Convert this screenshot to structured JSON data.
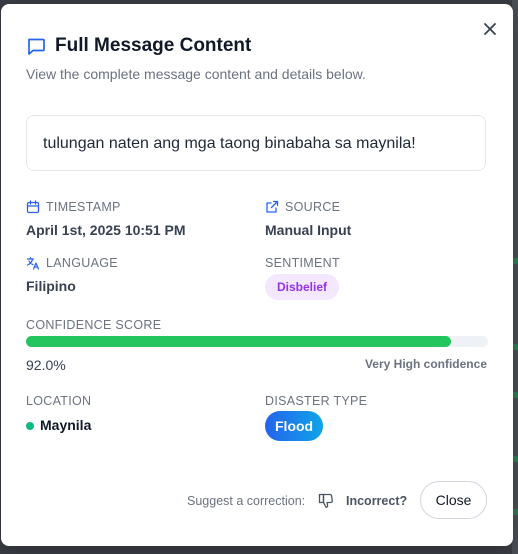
{
  "dialog": {
    "title": "Full Message Content",
    "subtitle": "View the complete message content and details below."
  },
  "message": {
    "text": "tulungan naten ang mga taong binabaha sa maynila!"
  },
  "details": {
    "timestamp": {
      "label": "TIMESTAMP",
      "value": "April 1st, 2025 10:51 PM"
    },
    "source": {
      "label": "SOURCE",
      "value": "Manual Input"
    },
    "language": {
      "label": "LANGUAGE",
      "value": "Filipino"
    },
    "sentiment": {
      "label": "SENTIMENT",
      "value": "Disbelief"
    },
    "confidence": {
      "label": "CONFIDENCE SCORE",
      "value_text": "92.0%",
      "fraction": 0.92,
      "description": "Very High confidence"
    },
    "location": {
      "label": "LOCATION",
      "value": "Maynila"
    },
    "disaster_type": {
      "label": "DISASTER TYPE",
      "value": "Flood"
    }
  },
  "footer": {
    "suggest_text": "Suggest a correction:",
    "incorrect_label": "Incorrect?",
    "close_label": "Close"
  },
  "colors": {
    "accent": "#2563eb",
    "confidence_bar": "#22c55e",
    "sentiment_badge_bg": "#f3e8ff",
    "sentiment_badge_text": "#9333ea",
    "location_dot": "#10b981"
  },
  "icons": {
    "title": "message-square-icon",
    "timestamp": "calendar-icon",
    "source": "external-link-icon",
    "language": "translate-icon",
    "close": "close-icon",
    "feedback": "thumbs-down-icon"
  }
}
